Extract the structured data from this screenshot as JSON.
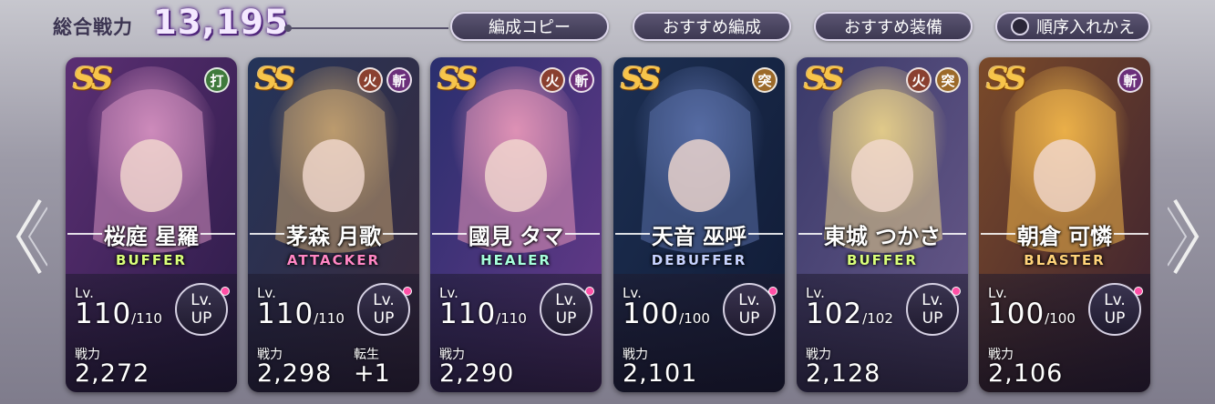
{
  "header": {
    "total_power_label": "総合戦力",
    "total_power_value": "13,195",
    "buttons": {
      "copy_formation": "編成コピー",
      "recommended_formation": "おすすめ編成",
      "recommended_equipment": "おすすめ装備",
      "swap_order": "順序入れかえ"
    }
  },
  "common": {
    "rank": "SS",
    "lv_label": "Lv.",
    "lvup_line1": "Lv.",
    "lvup_line2": "UP",
    "power_label": "戦力",
    "rebirth_label": "転生"
  },
  "cards": [
    {
      "name": "桜庭 星羅",
      "role": "BUFFER",
      "level": "110",
      "max_level": "/110",
      "power": "2,272",
      "attributes": [
        {
          "label": "打",
          "type": "strike"
        }
      ]
    },
    {
      "name": "茅森 月歌",
      "role": "ATTACKER",
      "level": "110",
      "max_level": "/110",
      "power": "2,298",
      "rebirth": "+1",
      "attributes": [
        {
          "label": "火",
          "type": "fire"
        },
        {
          "label": "斬",
          "type": "slash"
        }
      ]
    },
    {
      "name": "國見 タマ",
      "role": "HEALER",
      "level": "110",
      "max_level": "/110",
      "power": "2,290",
      "attributes": [
        {
          "label": "火",
          "type": "fire"
        },
        {
          "label": "斬",
          "type": "slash"
        }
      ]
    },
    {
      "name": "天音 巫呼",
      "role": "DEBUFFER",
      "level": "100",
      "max_level": "/100",
      "power": "2,101",
      "attributes": [
        {
          "label": "突",
          "type": "pierce"
        }
      ]
    },
    {
      "name": "東城 つかさ",
      "role": "BUFFER",
      "level": "102",
      "max_level": "/102",
      "power": "2,128",
      "attributes": [
        {
          "label": "火",
          "type": "fire"
        },
        {
          "label": "突",
          "type": "pierce"
        }
      ]
    },
    {
      "name": "朝倉 可憐",
      "role": "BLASTER",
      "level": "100",
      "max_level": "/100",
      "power": "2,106",
      "attributes": [
        {
          "label": "斬",
          "type": "slash"
        }
      ]
    }
  ],
  "colors": {
    "card_backgrounds": [
      [
        "#5b2f73",
        "#2b1b47",
        "#d48fbf"
      ],
      [
        "#24345a",
        "#3c2a3a",
        "#c2a070"
      ],
      [
        "#2a2f6e",
        "#6a3a8a",
        "#e596b8"
      ],
      [
        "#1c2f52",
        "#101a34",
        "#5a6fa8"
      ],
      [
        "#3a3a6a",
        "#6a5a8a",
        "#e8d08a"
      ],
      [
        "#7a4a2a",
        "#3a2030",
        "#f0b54a"
      ]
    ],
    "icons": {
      "left": "chevron-left-icon",
      "right": "chevron-right-icon"
    }
  }
}
